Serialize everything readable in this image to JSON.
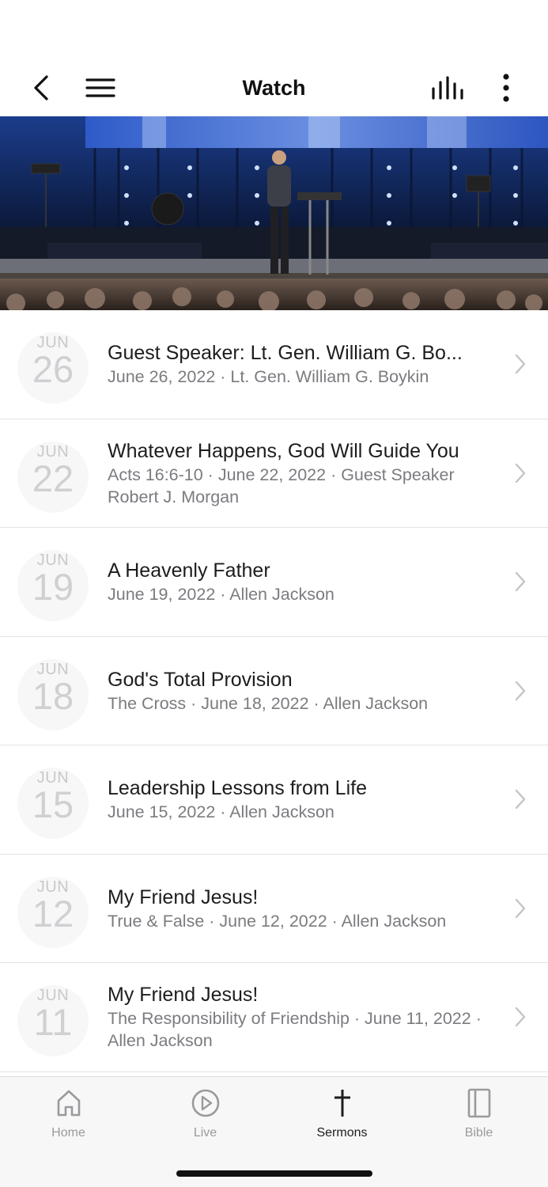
{
  "header": {
    "title": "Watch"
  },
  "sermons": [
    {
      "month": "JUN",
      "day": "26",
      "title": "Guest Speaker: Lt. Gen. William G. Bo...",
      "subtitle": "June 26, 2022 · Lt. Gen. William G. Boykin"
    },
    {
      "month": "JUN",
      "day": "22",
      "title": "Whatever Happens, God Will Guide You",
      "subtitle": "Acts 16:6-10 · June 22, 2022 · Guest Speaker Robert J. Morgan"
    },
    {
      "month": "JUN",
      "day": "19",
      "title": "A Heavenly Father",
      "subtitle": "June 19, 2022 · Allen Jackson"
    },
    {
      "month": "JUN",
      "day": "18",
      "title": "God's Total Provision",
      "subtitle": "The Cross · June 18, 2022 · Allen Jackson"
    },
    {
      "month": "JUN",
      "day": "15",
      "title": "Leadership Lessons from Life",
      "subtitle": "June 15, 2022 · Allen Jackson"
    },
    {
      "month": "JUN",
      "day": "12",
      "title": "My Friend Jesus!",
      "subtitle": "True & False · June 12, 2022 · Allen Jackson"
    },
    {
      "month": "JUN",
      "day": "11",
      "title": "My Friend Jesus!",
      "subtitle": "The Responsibility of Friendship · June 11, 2022 · Allen Jackson"
    }
  ],
  "tabs": [
    {
      "label": "Home",
      "icon": "home-icon",
      "active": false
    },
    {
      "label": "Live",
      "icon": "play-circle-icon",
      "active": false
    },
    {
      "label": "Sermons",
      "icon": "cross-icon",
      "active": true
    },
    {
      "label": "Bible",
      "icon": "book-icon",
      "active": false
    }
  ],
  "colors": {
    "text_primary": "#1d1d1f",
    "text_secondary": "#7b7b80",
    "tab_inactive": "#9a9a9e",
    "date_badge": "#d0d0d3"
  }
}
